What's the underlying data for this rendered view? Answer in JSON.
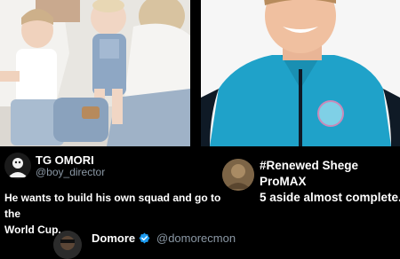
{
  "tweet_main": {
    "display_name": "TG OMORI",
    "handle": "@boy_director",
    "text_line1": "He wants to build his own squad and go to the",
    "text_line2": "World Cup."
  },
  "tweet_right": {
    "text_line1": "#Renewed Shege ProMAX",
    "text_line2": "5 aside almost complete."
  },
  "tweet_bottom": {
    "display_name": "Domore",
    "handle": "@domorecmon"
  },
  "icons": [
    "verified-badge-icon"
  ],
  "colors": {
    "background": "#000000",
    "handle_gray": "#8b98a5",
    "verified_blue": "#1d9bf0",
    "jersey_blue": "#1fa2c9"
  }
}
